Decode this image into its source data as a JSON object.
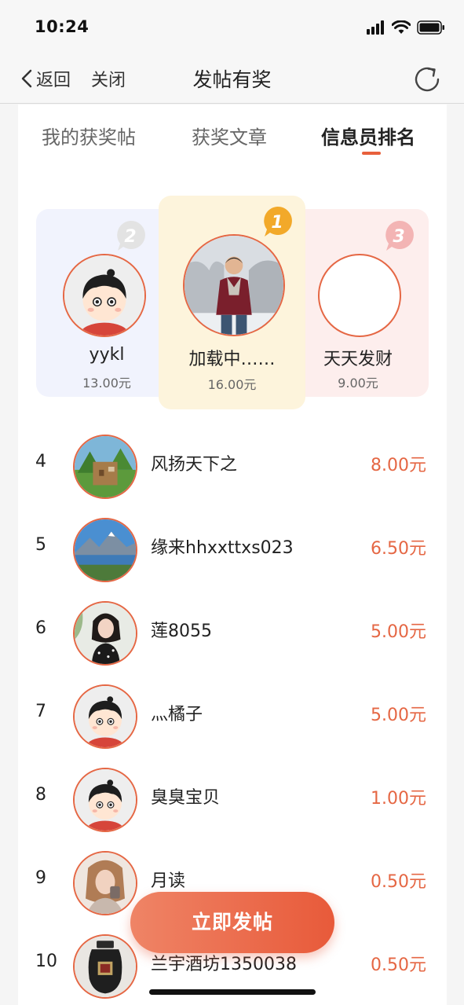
{
  "status_bar": {
    "time": "10:24"
  },
  "nav": {
    "back_label": "返回",
    "close_label": "关闭",
    "title": "发帖有奖"
  },
  "tabs": [
    {
      "label": "我的获奖帖",
      "active": false
    },
    {
      "label": "获奖文章",
      "active": false
    },
    {
      "label": "信息员排名",
      "active": true
    }
  ],
  "podium": {
    "first": {
      "rank": "1",
      "name": "加载中……",
      "amount": "16.00元",
      "avatar": "man-in-snow-photo"
    },
    "second": {
      "rank": "2",
      "name": "yykl",
      "amount": "13.00元",
      "avatar": "default-cartoon-avatar"
    },
    "third": {
      "rank": "3",
      "name": "天天发财",
      "amount": "9.00元",
      "avatar": "empty-avatar"
    }
  },
  "ranking": [
    {
      "rank": "4",
      "name": "风扬天下之",
      "amount": "8.00元",
      "avatar": "game-scene-avatar"
    },
    {
      "rank": "5",
      "name": "缘来hhxxttxs023",
      "amount": "6.50元",
      "avatar": "mountain-lake-avatar"
    },
    {
      "rank": "6",
      "name": "莲8055",
      "amount": "5.00元",
      "avatar": "woman-photo-avatar"
    },
    {
      "rank": "7",
      "name": "灬橘子",
      "amount": "5.00元",
      "avatar": "default-cartoon-avatar"
    },
    {
      "rank": "8",
      "name": "臭臭宝贝",
      "amount": "1.00元",
      "avatar": "default-cartoon-avatar"
    },
    {
      "rank": "9",
      "name": "月读",
      "amount": "0.50元",
      "avatar": "woman-selfie-avatar"
    },
    {
      "rank": "10",
      "name": "兰宇酒坊1350038",
      "amount": "0.50元",
      "avatar": "wine-jar-avatar"
    }
  ],
  "actions": {
    "post_label": "立即发帖"
  },
  "colors": {
    "accent": "#e56744",
    "first_bg": "#fdf4dc",
    "second_bg": "#f1f3fd",
    "third_bg": "#fdeeed"
  }
}
